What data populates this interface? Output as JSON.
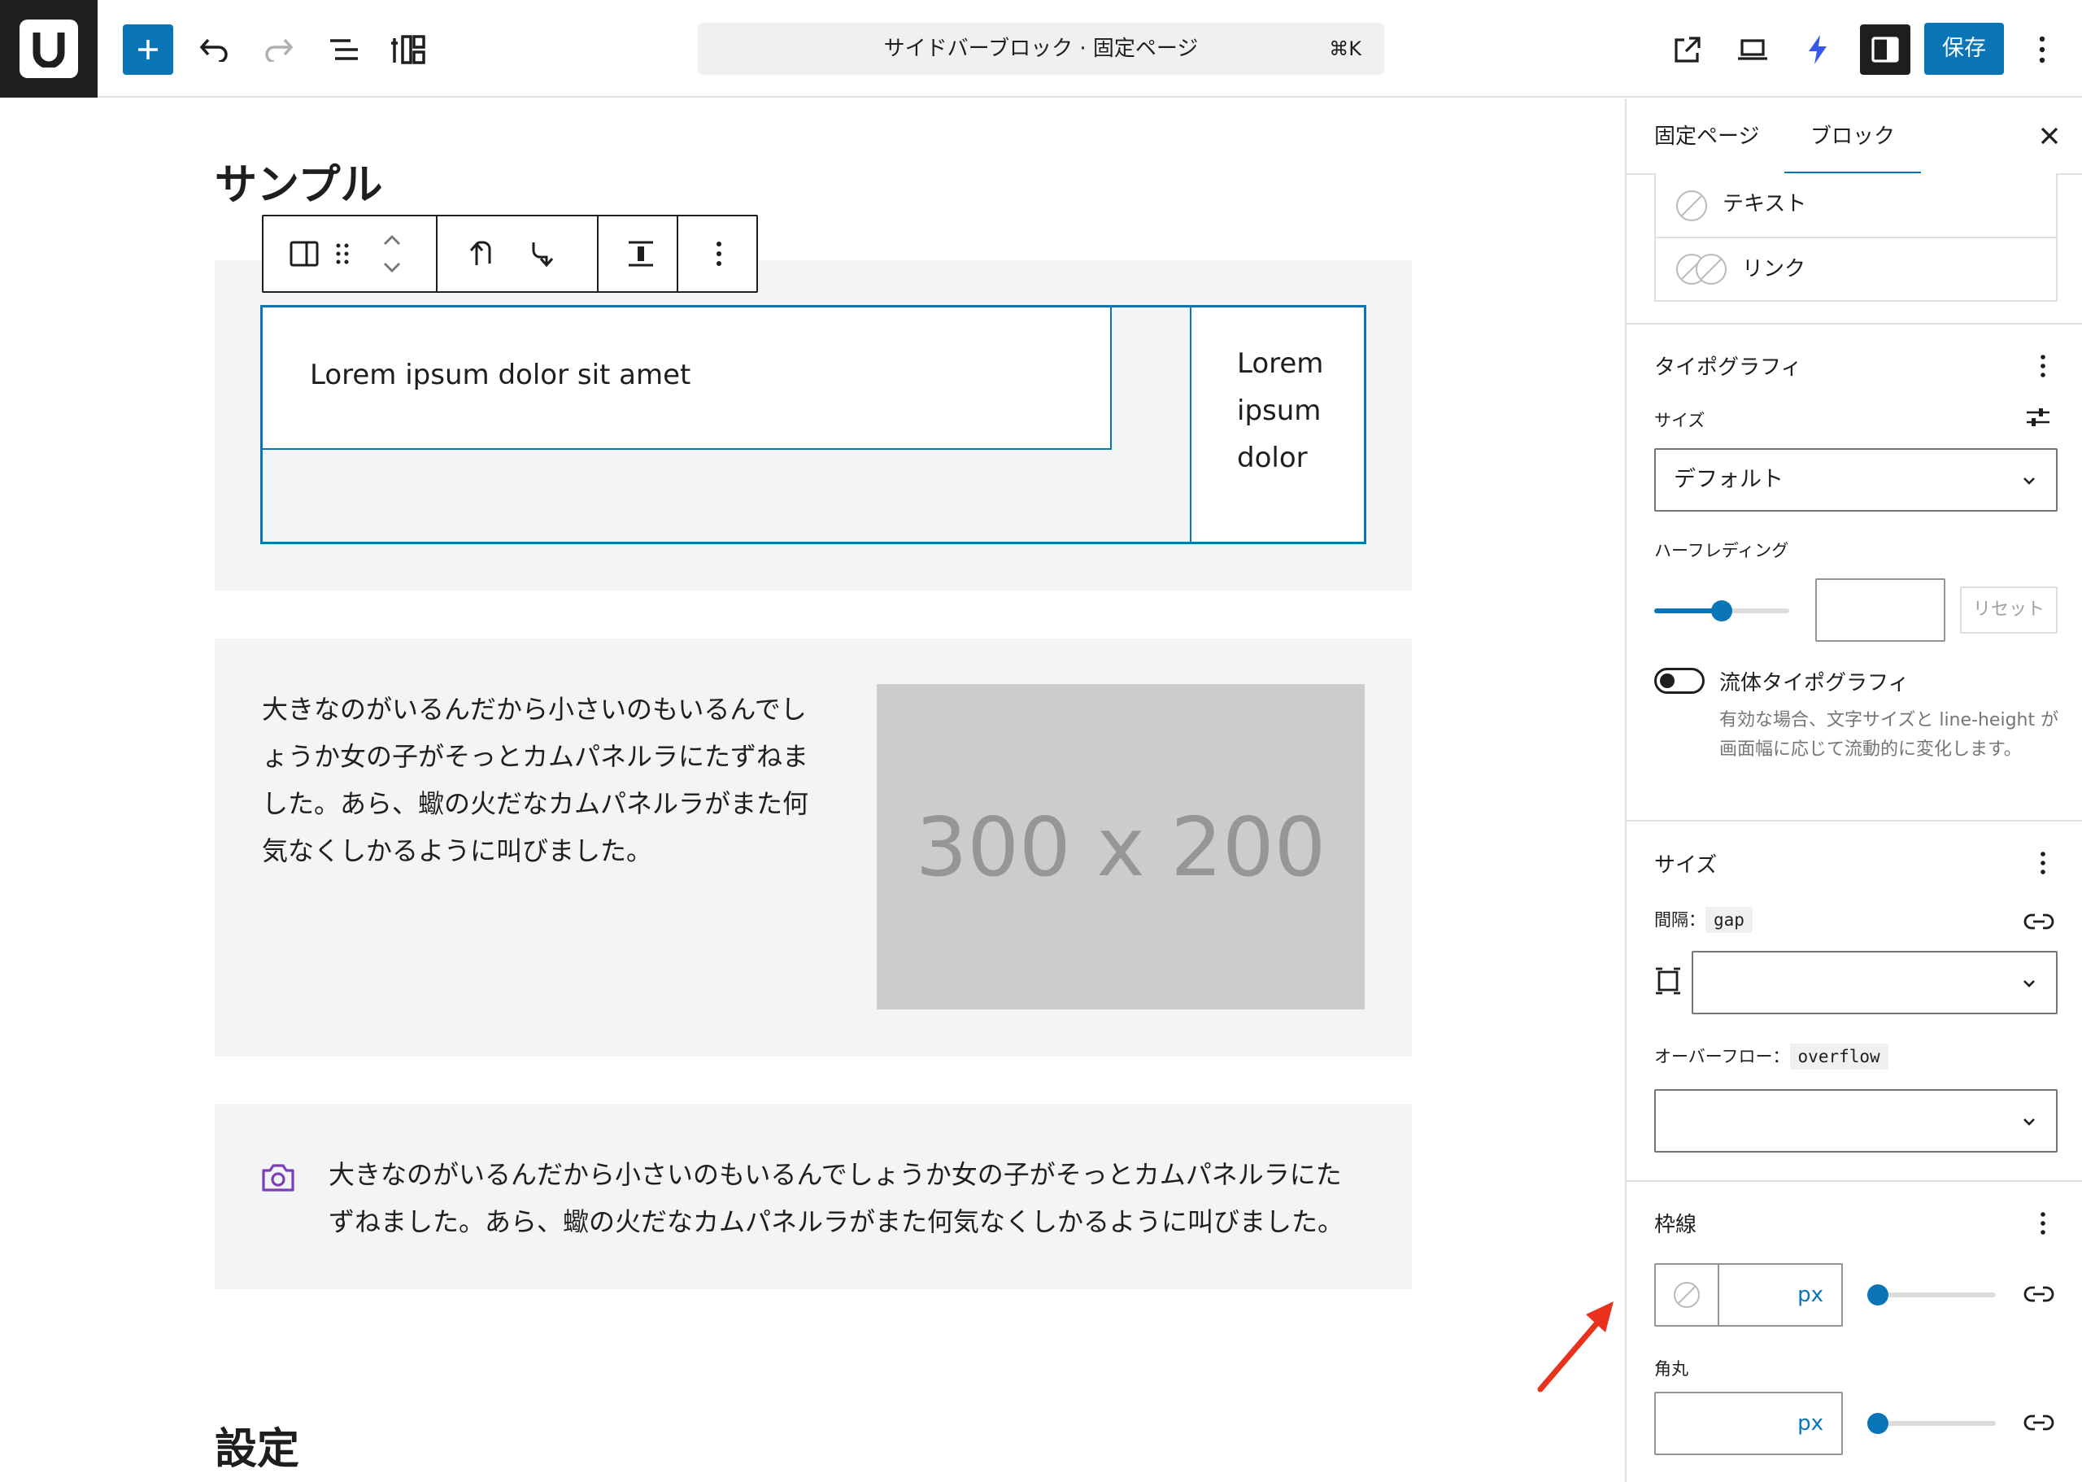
{
  "header": {
    "command_title": "サイドバーブロック · 固定ページ",
    "command_shortcut": "⌘K",
    "save_label": "保存"
  },
  "editor": {
    "heading_sample": "サンプル",
    "heading_settings": "設定",
    "sidebar_main_text": "Lorem ipsum dolor sit amet",
    "sidebar_side_text": [
      "Lorem",
      "ipsum",
      "dolor"
    ],
    "media_text_lines": [
      "大きなのがいるんだから小さいのもいるんでし",
      "ょうか女の子がそっとカムパネルラにたずねま",
      "した。あら、蠍の火だなカムパネルラがまた何",
      "気なくしかるように叫びました。"
    ],
    "placeholder_image_text": "300 x 200",
    "icon_text_lines": [
      "大きなのがいるんだから小さいのもいるんでしょうか女の子がそっとカムパネルラにた",
      "ずねました。あら、蠍の火だなカムパネルラがまた何気なくしかるように叫びました。"
    ]
  },
  "sidebar": {
    "tabs": [
      "固定ページ",
      "ブロック"
    ],
    "active_tab": "ブロック",
    "colors": {
      "text_label": "テキスト",
      "link_label": "リンク"
    },
    "typography": {
      "title": "タイポグラフィ",
      "size_label": "サイズ",
      "size_value": "デフォルト",
      "half_leading_label": "ハーフレディング",
      "half_leading_slider": 0.5,
      "reset_label": "リセット",
      "fluid_label": "流体タイポグラフィ",
      "fluid_help": "有効な場合、文字サイズと line-height が画面幅に応じて流動的に変化します。"
    },
    "dimensions": {
      "title": "サイズ",
      "gap_label": "間隔：",
      "gap_code": "gap",
      "overflow_label": "オーバーフロー：",
      "overflow_code": "overflow"
    },
    "border": {
      "title": "枠線",
      "width_unit": "px",
      "radius_label": "角丸",
      "radius_unit": "px"
    }
  },
  "colors": {
    "accent": "#0a75b6",
    "dark": "#1e1e1e",
    "camera_icon": "#7b3fb8",
    "arrow": "#e8321e"
  }
}
